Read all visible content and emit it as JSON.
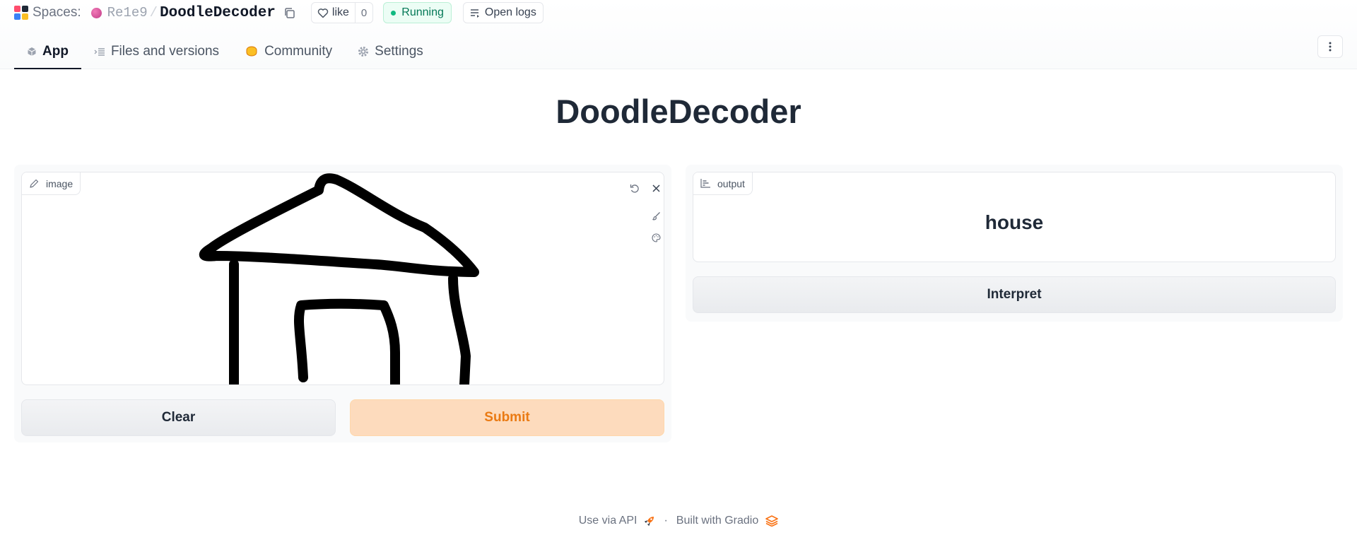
{
  "header": {
    "spaces_label": "Spaces:",
    "owner": "Re1e9",
    "separator": "/",
    "repo_name": "DoodleDecoder",
    "like_label": "like",
    "like_count": "0",
    "status": "Running",
    "status_color": "#047857",
    "logs_label": "Open logs"
  },
  "tabs": [
    {
      "label": "App",
      "icon": "cube-icon",
      "active": true
    },
    {
      "label": "Files and versions",
      "icon": "files-icon",
      "active": false
    },
    {
      "label": "Community",
      "icon": "community-icon",
      "active": false
    },
    {
      "label": "Settings",
      "icon": "gear-icon",
      "active": false
    }
  ],
  "app": {
    "title": "DoodleDecoder",
    "input": {
      "label": "image",
      "content": "hand-drawn black sketch of a house (roof, walls, door)",
      "tools": [
        "undo-icon",
        "close-icon",
        "brush-icon",
        "palette-icon"
      ]
    },
    "clear_label": "Clear",
    "submit_label": "Submit",
    "output": {
      "label": "output",
      "value": "house"
    },
    "interpret_label": "Interpret",
    "accent_color": "#ea7a13"
  },
  "footer": {
    "api_label": "Use via API",
    "separator": "·",
    "built_label": "Built with Gradio"
  }
}
